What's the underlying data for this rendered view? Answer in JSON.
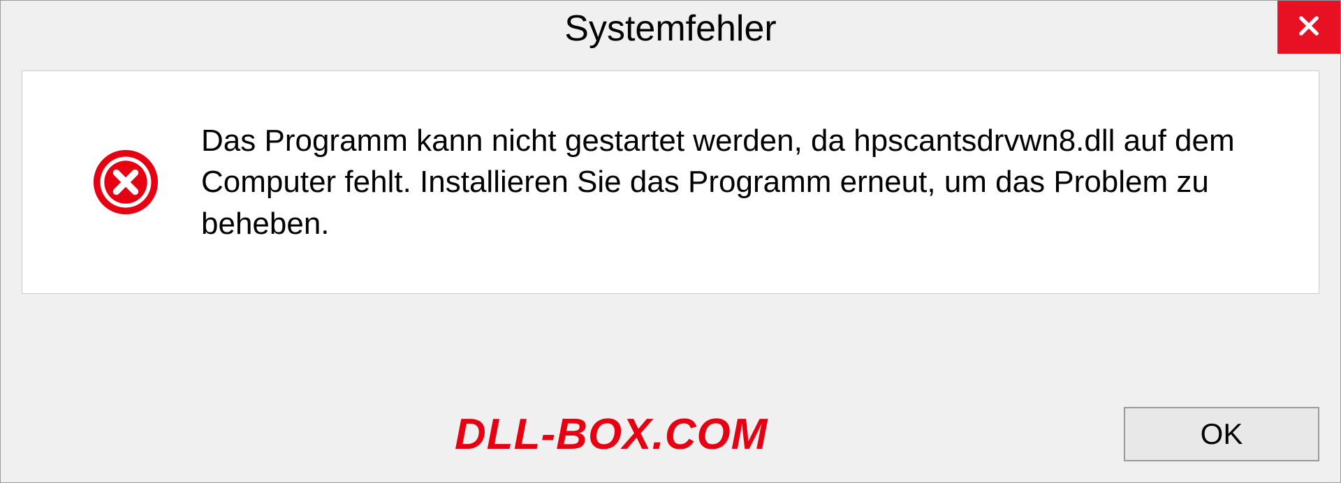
{
  "dialog": {
    "title": "Systemfehler",
    "message": "Das Programm kann nicht gestartet werden, da hpscantsdrvwn8.dll auf dem Computer fehlt. Installieren Sie das Programm erneut, um das Problem zu beheben.",
    "ok_label": "OK"
  },
  "watermark": "DLL-BOX.COM"
}
